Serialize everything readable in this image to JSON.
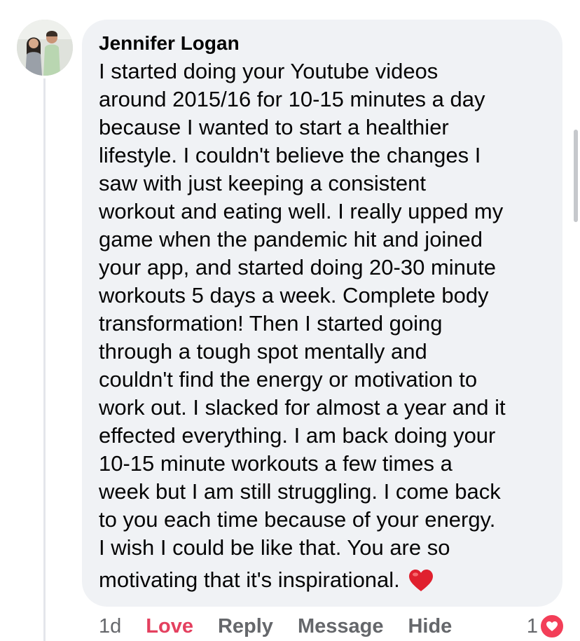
{
  "comment": {
    "author": "Jennifer Logan",
    "lines": [
      "I started doing your Youtube videos",
      "around 2015/16 for 10-15 minutes a day",
      "because I wanted to start a healthier",
      "lifestyle. I couldn't believe the changes I",
      "saw with just keeping a consistent",
      "workout and eating well. I really upped my",
      "game when the pandemic hit and joined",
      "your app, and started doing 20-30 minute",
      "workouts 5 days a week. Complete body",
      "transformation! Then I started going",
      "through a tough spot mentally and",
      "couldn't find the energy or motivation to",
      "work out. I slacked for almost a year and it",
      "effected everything. I am back doing your",
      "10-15 minute workouts a few times a",
      "week but I am still struggling. I come back",
      "to you each time because of your energy.",
      "I wish I could be like that. You are so",
      "motivating that it's inspirational."
    ],
    "trailing_emoji": "heart-emoji"
  },
  "actions": {
    "timestamp": "1d",
    "love_label": "Love",
    "reply_label": "Reply",
    "message_label": "Message",
    "hide_label": "Hide"
  },
  "reactions": {
    "count": "1",
    "icon": "heart-reaction-icon"
  },
  "colors": {
    "bubble": "#f0f2f5",
    "love_active": "#e4405f",
    "muted": "#65676b",
    "heart": "#f33e58"
  }
}
